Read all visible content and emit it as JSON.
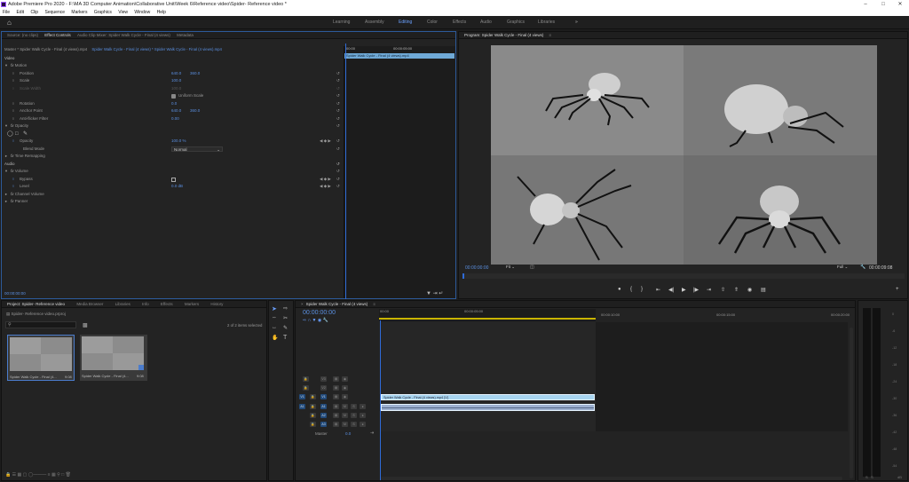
{
  "app": {
    "title": "Adobe Premiere Pro 2020 - F:\\MA 3D Computer Animation\\Collaborative Unit\\Week 6\\Reference video\\Spider- Reference video *"
  },
  "menu": [
    "File",
    "Edit",
    "Clip",
    "Sequence",
    "Markers",
    "Graphics",
    "View",
    "Window",
    "Help"
  ],
  "workspaces": [
    {
      "label": "Learning",
      "active": false
    },
    {
      "label": "Assembly",
      "active": false
    },
    {
      "label": "Editing",
      "active": true
    },
    {
      "label": "Color",
      "active": false
    },
    {
      "label": "Effects",
      "active": false
    },
    {
      "label": "Audio",
      "active": false
    },
    {
      "label": "Graphics",
      "active": false
    },
    {
      "label": "Libraries",
      "active": false
    }
  ],
  "effect_panel": {
    "tabs": [
      "Source: (no clips)",
      "Effect Controls",
      "Audio Clip Mixer: Spider Walk Cycle - Final (4 views)",
      "Metadata"
    ],
    "master": "Master * Spider Walk Cycle - Final (4 views).mp4",
    "clip_path": "Spider Walk Cycle - Final (4 views) * Spider Walk Cycle - Final (4 views).mp4",
    "mini_tc_start": "00:00",
    "mini_tc_end": "00:00:05:00",
    "mini_clip": "Spider Walk Cycle - Final (4 views).mp4",
    "video_label": "Video",
    "rows": [
      {
        "label": "Motion",
        "value": "",
        "value2": "",
        "fx": true
      },
      {
        "label": "Position",
        "value": "640.0",
        "value2": "360.0"
      },
      {
        "label": "Scale",
        "value": "100.0",
        "value2": ""
      },
      {
        "label": "Scale Width",
        "value": "100.0",
        "value2": "",
        "dim": true
      },
      {
        "label": "",
        "value": "Uniform Scale",
        "value2": ""
      },
      {
        "label": "Rotation",
        "value": "0.0",
        "value2": ""
      },
      {
        "label": "Anchor Point",
        "value": "640.0",
        "value2": "360.0"
      },
      {
        "label": "Anti-flicker Filter",
        "value": "0.00",
        "value2": ""
      },
      {
        "label": "Opacity",
        "value": "",
        "value2": "",
        "fx": true
      },
      {
        "label": "",
        "value": "",
        "value2": ""
      },
      {
        "label": "Opacity",
        "value": "100.0 %",
        "value2": ""
      },
      {
        "label": "Blend Mode",
        "value": "Normal",
        "value2": ""
      },
      {
        "label": "Time Remapping",
        "value": "",
        "value2": "",
        "fx": true
      },
      {
        "label": "Audio",
        "value": "",
        "value2": ""
      },
      {
        "label": "Volume",
        "value": "",
        "value2": "",
        "fx": true
      },
      {
        "label": "Bypass",
        "value": "",
        "value2": ""
      },
      {
        "label": "Level",
        "value": "0.0 dB",
        "value2": ""
      },
      {
        "label": "Channel Volume",
        "value": "",
        "value2": "",
        "fx": true
      },
      {
        "label": "Panner",
        "value": "",
        "value2": "",
        "fx": true
      }
    ],
    "timecode": "00:00:00:00"
  },
  "program": {
    "title": "Program: Spider Walk Cycle - Final (4 views)",
    "timecode": "00:00:00:00",
    "fit": "Fit",
    "quality": "Full",
    "duration": "00:00:09:08"
  },
  "project": {
    "tabs": [
      "Project: Spider- Reference video",
      "Media Browser",
      "Libraries",
      "Info",
      "Effects",
      "Markers",
      "History"
    ],
    "file": "Spider- Reference video.prproj",
    "count": "2 of 2 items selected",
    "items": [
      {
        "name": "Spider Walk Cycle - Final (4...",
        "duration": "9:08"
      },
      {
        "name": "Spider Walk Cycle - Final (4...",
        "duration": "9:08"
      }
    ]
  },
  "timeline": {
    "title": "Spider Walk Cycle - Final (4 views)",
    "timecode": "00:00:00:00",
    "ruler": [
      "00:00",
      "00:00:05:00",
      "00:00:10:00",
      "00:00:15:00",
      "00:00:20:00"
    ],
    "video_tracks": [
      "V3",
      "V2",
      "V1"
    ],
    "audio_tracks": [
      "A1",
      "A2",
      "A3"
    ],
    "master_label": "Master",
    "master_value": "0.0",
    "clip_label": "Spider Walk Cycle - Final (4 views).mp4 [V]"
  },
  "meter": {
    "scale": [
      "0",
      "-6",
      "-12",
      "-18",
      "-24",
      "-30",
      "-36",
      "-42",
      "-48",
      "-54",
      "dB"
    ]
  },
  "colors": {
    "accent": "#5a8fe0",
    "clip_video": "#a8d5f0",
    "clip_audio": "#9cb0d0",
    "playhead": "#2f6bd7"
  }
}
